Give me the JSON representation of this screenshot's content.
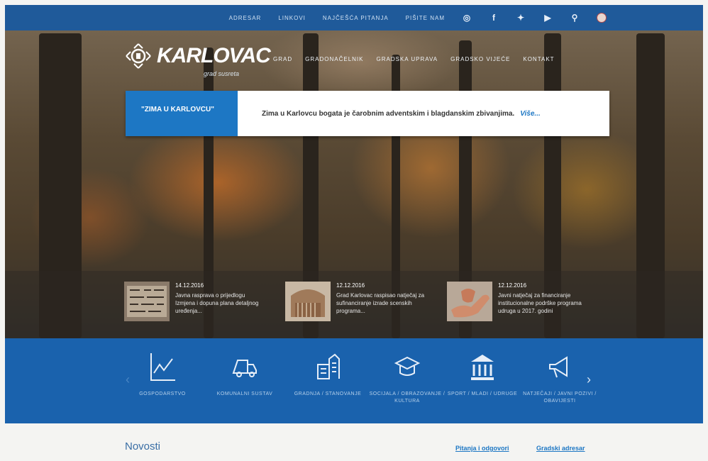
{
  "top_nav": {
    "links": [
      "ADRESAR",
      "LINKOVI",
      "NAJČEŠĆA PITANJA",
      "PIŠITE NAM"
    ],
    "icons": [
      "accessibility-icon",
      "facebook-icon",
      "twitter-icon",
      "youtube-icon",
      "search-icon",
      "coat-of-arms-icon"
    ]
  },
  "logo": {
    "word": "KARLOVAC",
    "sub": "grad susreta"
  },
  "main_nav": [
    "GRAD",
    "GRADONAČELNIK",
    "GRADSKA UPRAVA",
    "GRADSKO VIJEĆE",
    "KONTAKT"
  ],
  "banner": {
    "tag": "\"ZIMA U KARLOVCU\"",
    "message": "Zima u Karlovcu bogata je čarobnim adventskim i blagdanskim zbivanjima.",
    "more": "Više..."
  },
  "news": [
    {
      "date": "14.12.2016",
      "text": "Javna rasprava o prijedlogu Izmjena i dopuna plana detaljnog uređenja..."
    },
    {
      "date": "12.12.2016",
      "text": "Grad Karlovac raspisao natječaj za sufinanciranje izrade scenskih programa..."
    },
    {
      "date": "12.12.2016",
      "text": "Javni natječaj za financiranje institucionalne podrške programa udruga u 2017. godini"
    }
  ],
  "categories": [
    {
      "label": "GOSPODARSTVO",
      "icon": "chart-icon"
    },
    {
      "label": "KOMUNALNI SUSTAV",
      "icon": "truck-icon"
    },
    {
      "label": "GRADNJA / STANOVANJE",
      "icon": "building-icon"
    },
    {
      "label": "SOCIJALA / OBRAZOVANJE / KULTURA",
      "icon": "graduation-cap-icon"
    },
    {
      "label": "SPORT / MLADI / UDRUGE",
      "icon": "institution-icon"
    },
    {
      "label": "NATJEČAJI / JAVNI POZIVI / OBAVIJESTI",
      "icon": "megaphone-icon"
    }
  ],
  "bottom": {
    "title": "Novosti",
    "link1": "Pitanja i odgovori",
    "link2": "Gradski adresar"
  },
  "colors": {
    "blue": "#1a62ad",
    "accent": "#1d77c4"
  }
}
